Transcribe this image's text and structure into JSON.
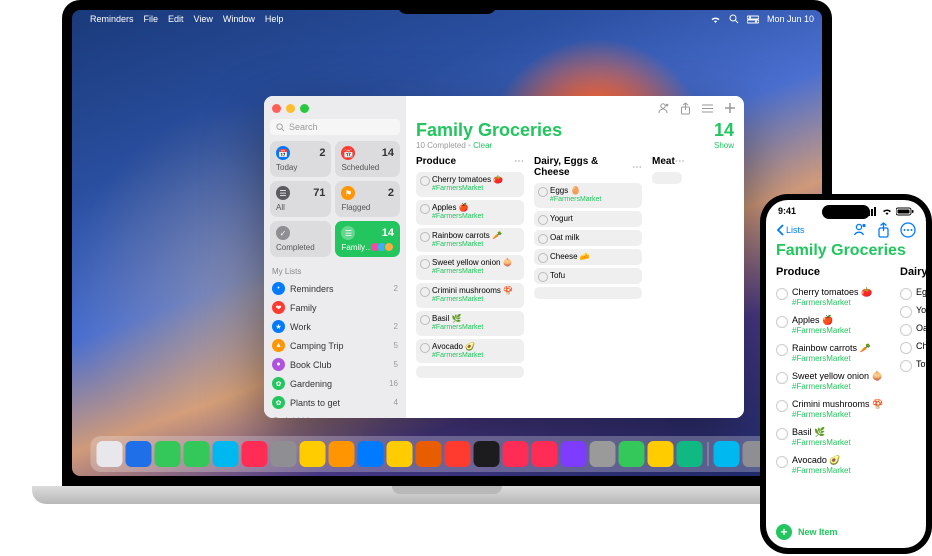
{
  "menubar": {
    "app": "Reminders",
    "items": [
      "File",
      "Edit",
      "View",
      "Window",
      "Help"
    ],
    "clock": "Mon Jun 10"
  },
  "reminders": {
    "search_placeholder": "Search",
    "smart": {
      "today": {
        "label": "Today",
        "count": "2"
      },
      "scheduled": {
        "label": "Scheduled",
        "count": "14"
      },
      "all": {
        "label": "All",
        "count": "71"
      },
      "flagged": {
        "label": "Flagged",
        "count": "2"
      },
      "completed": {
        "label": "Completed",
        "count": ""
      },
      "family": {
        "label": "Family…",
        "count": "14"
      }
    },
    "mylists_label": "My Lists",
    "lists": [
      {
        "label": "Reminders",
        "count": "2",
        "color": "#007aff",
        "icon": "•"
      },
      {
        "label": "Family",
        "count": "",
        "color": "#ff3b30",
        "icon": "❤"
      },
      {
        "label": "Work",
        "count": "2",
        "color": "#007aff",
        "icon": "★"
      },
      {
        "label": "Camping Trip",
        "count": "5",
        "color": "#ff9500",
        "icon": "▲"
      },
      {
        "label": "Book Club",
        "count": "5",
        "color": "#af52de",
        "icon": "●"
      },
      {
        "label": "Gardening",
        "count": "16",
        "color": "#22c55e",
        "icon": "✿"
      },
      {
        "label": "Plants to get",
        "count": "4",
        "color": "#22c55e",
        "icon": "✿"
      }
    ],
    "add_list": "Add List",
    "title": "Family Groceries",
    "big_count": "14",
    "completed_text": "10 Completed",
    "clear": "Clear",
    "show": "Show",
    "columns": [
      {
        "header": "Produce",
        "items": [
          {
            "text": "Cherry tomatoes 🍅",
            "tag": "#FarmersMarket"
          },
          {
            "text": "Apples 🍎",
            "tag": "#FarmersMarket"
          },
          {
            "text": "Rainbow carrots 🥕",
            "tag": "#FarmersMarket"
          },
          {
            "text": "Sweet yellow onion 🧅",
            "tag": "#FarmersMarket"
          },
          {
            "text": "Crimini mushrooms 🍄",
            "tag": "#FarmersMarket"
          },
          {
            "text": "Basil 🌿",
            "tag": "#FarmersMarket"
          },
          {
            "text": "Avocado 🥑",
            "tag": "#FarmersMarket"
          }
        ]
      },
      {
        "header": "Dairy, Eggs & Cheese",
        "items": [
          {
            "text": "Eggs 🥚",
            "tag": "#FarmersMarket"
          },
          {
            "text": "Yogurt"
          },
          {
            "text": "Oat milk"
          },
          {
            "text": "Cheese 🧀"
          },
          {
            "text": "Tofu"
          }
        ]
      },
      {
        "header": "Meat",
        "items": []
      }
    ]
  },
  "iphone": {
    "time": "9:41",
    "back": "Lists",
    "title": "Family Groceries",
    "col1_header": "Produce",
    "col2_header": "Dairy,",
    "col1": [
      {
        "text": "Cherry tomatoes 🍅",
        "tag": "#FarmersMarket"
      },
      {
        "text": "Apples 🍎",
        "tag": "#FarmersMarket"
      },
      {
        "text": "Rainbow carrots 🥕",
        "tag": "#FarmersMarket"
      },
      {
        "text": "Sweet yellow onion 🧅",
        "tag": "#FarmersMarket"
      },
      {
        "text": "Crimini mushrooms 🍄",
        "tag": "#FarmersMarket"
      },
      {
        "text": "Basil 🌿",
        "tag": "#FarmersMarket"
      },
      {
        "text": "Avocado 🥑",
        "tag": "#FarmersMarket"
      }
    ],
    "col2": [
      {
        "text": "Egg"
      },
      {
        "text": "Yog"
      },
      {
        "text": "Oat"
      },
      {
        "text": "Che"
      },
      {
        "text": "Tof"
      }
    ],
    "new_item": "New Item"
  },
  "dock_colors": [
    "#e8e8ec",
    "#1e6fe8",
    "#34c759",
    "#34c759",
    "#00b8f0",
    "#ff2d55",
    "#8e8e93",
    "#ffcc00",
    "#ff9500",
    "#007aff",
    "#ffcc00",
    "#e85d00",
    "#ff3b30",
    "#1c1c1e",
    "#ff2d55",
    "#ff2d55",
    "#7d3cff",
    "#9a9a9a",
    "#34c759",
    "#ffcc00",
    "#10b981",
    "#00b8f0",
    "#8e8e93",
    "#3478f6"
  ]
}
